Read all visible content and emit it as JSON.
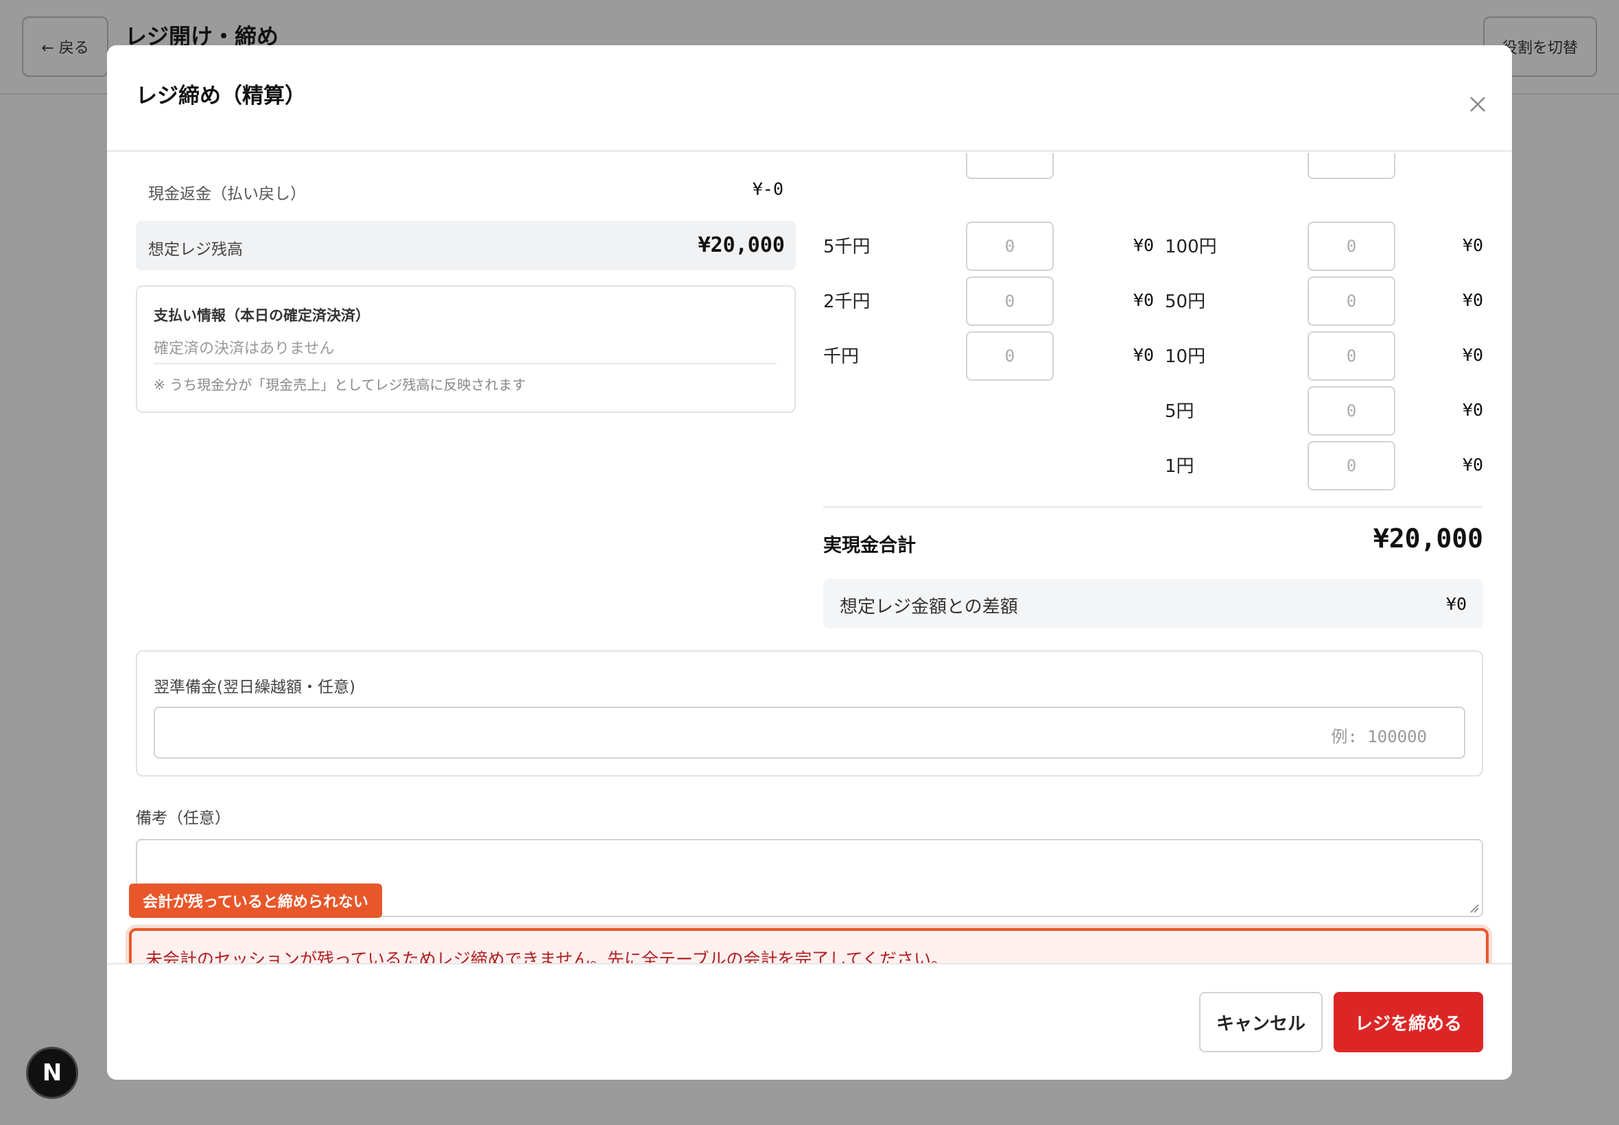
{
  "background": {
    "back_label": "← 戻る",
    "page_title": "レジ開け・締め",
    "role_button": "役割を切替",
    "n_badge": "N"
  },
  "modal": {
    "title": "レジ締め（精算）",
    "refund": {
      "label": "現金返金（払い戻し）",
      "value": "¥-0"
    },
    "expected": {
      "label": "想定レジ残高",
      "value": "¥20,000"
    },
    "payment_info": {
      "title": "支払い情報（本日の確定済決済）",
      "empty": "確定済の決済はありません",
      "note": "※ うち現金分が「現金売上」としてレジ残高に反映されます"
    },
    "denominations_left": [
      {
        "label": "5千円",
        "count_placeholder": "0",
        "subtotal": "¥0"
      },
      {
        "label": "2千円",
        "count_placeholder": "0",
        "subtotal": "¥0"
      },
      {
        "label": "千円",
        "count_placeholder": "0",
        "subtotal": "¥0"
      }
    ],
    "denominations_right": [
      {
        "label": "100円",
        "count_placeholder": "0",
        "subtotal": "¥0"
      },
      {
        "label": "50円",
        "count_placeholder": "0",
        "subtotal": "¥0"
      },
      {
        "label": "10円",
        "count_placeholder": "0",
        "subtotal": "¥0"
      },
      {
        "label": "5円",
        "count_placeholder": "0",
        "subtotal": "¥0"
      },
      {
        "label": "1円",
        "count_placeholder": "0",
        "subtotal": "¥0"
      }
    ],
    "actual_total": {
      "label": "実現金合計",
      "value": "¥20,000"
    },
    "difference": {
      "label": "想定レジ金額との差額",
      "value": "¥0"
    },
    "reserve": {
      "label": "翌準備金(翌日繰越額・任意)",
      "placeholder": "例: 100000"
    },
    "memo": {
      "label": "備考（任意）"
    },
    "tag": "会計が残っていると締められない",
    "error": "未会計のセッションが残っているためレジ締めできません。先に全テーブルの会計を完了してください。",
    "cancel_button": "キャンセル",
    "confirm_button": "レジを締める"
  }
}
